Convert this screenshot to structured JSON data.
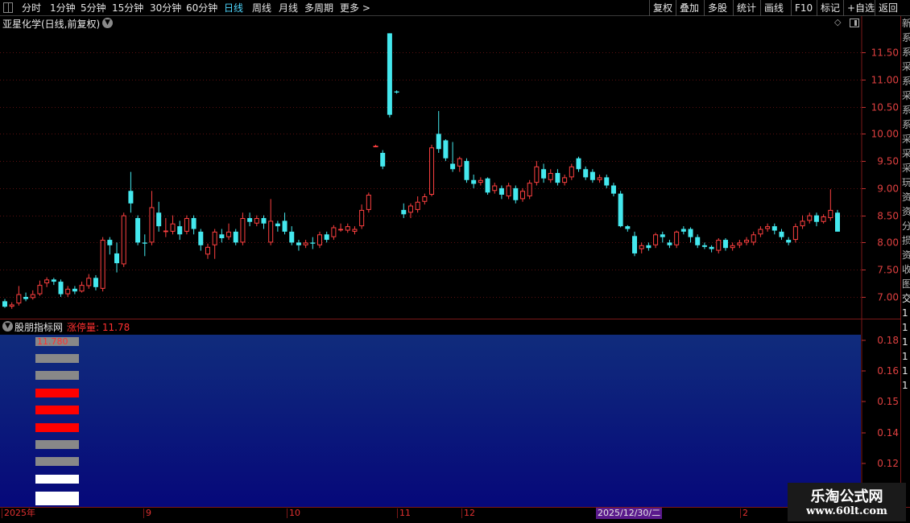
{
  "toolbar": {
    "periods": [
      "分时",
      "1分钟",
      "5分钟",
      "15分钟",
      "30分钟",
      "60分钟",
      "日线",
      "周线",
      "月线",
      "多周期",
      "更多 >"
    ],
    "active_period": "日线",
    "actions": [
      "复权",
      "叠加",
      "多股",
      "统计",
      "画线",
      "F10",
      "标记",
      "+自选",
      "返回"
    ]
  },
  "chart": {
    "title": "亚星化学(日线,前复权)",
    "y_ticks": [
      "11.50",
      "11.00",
      "10.50",
      "10.00",
      "9.50",
      "9.00",
      "8.50",
      "8.00",
      "7.50",
      "7.00"
    ]
  },
  "indicator": {
    "name": "股朋指标网",
    "series_label": "涨停量: 11.78",
    "top_value_label": "11.780",
    "y_ticks": [
      "0.18",
      "0.16",
      "0.15",
      "0.14",
      "0.12"
    ],
    "bar_colors": [
      "#888888",
      "#888888",
      "#888888",
      "#ff0000",
      "#ff0000",
      "#ff0000",
      "#888888",
      "#888888",
      "#ffffff",
      "#ffffff"
    ]
  },
  "date_axis": {
    "labels": [
      "2025年",
      "9",
      "10",
      "11",
      "12",
      "2"
    ],
    "cursor_date": "2025/12/30/二"
  },
  "right_strip_chars": [
    "新",
    "系",
    "系",
    "采",
    "系",
    "采",
    "系",
    "系",
    "采",
    "采",
    "采",
    "玩",
    "资",
    "资",
    "分",
    "损",
    "资",
    "收",
    "图",
    "交",
    "1",
    "1",
    "1",
    "1",
    "1",
    "1"
  ],
  "watermark": {
    "title": "乐淘公式网",
    "url": "www.60lt.com"
  },
  "colors": {
    "up": "#ff4040",
    "down": "#44e8ee",
    "grid": "#5a1010",
    "indicator_bg_top": "#102c7c",
    "indicator_bg_bottom": "#06087a"
  },
  "chart_data": {
    "type": "candlestick",
    "y_range": [
      6.6,
      11.9
    ],
    "candles": [
      [
        6.92,
        6.82,
        6.96,
        6.8
      ],
      [
        6.82,
        6.86,
        6.9,
        6.78
      ],
      [
        6.88,
        7.05,
        7.2,
        6.84
      ],
      [
        7.0,
        6.96,
        7.08,
        6.92
      ],
      [
        6.98,
        7.05,
        7.12,
        6.95
      ],
      [
        7.05,
        7.22,
        7.3,
        7.02
      ],
      [
        7.25,
        7.32,
        7.36,
        7.18
      ],
      [
        7.32,
        7.28,
        7.35,
        7.22
      ],
      [
        7.28,
        7.05,
        7.32,
        7.0
      ],
      [
        7.05,
        7.15,
        7.2,
        7.0
      ],
      [
        7.15,
        7.1,
        7.2,
        7.05
      ],
      [
        7.1,
        7.22,
        7.28,
        7.08
      ],
      [
        7.2,
        7.35,
        7.42,
        7.15
      ],
      [
        7.35,
        7.18,
        7.4,
        7.12
      ],
      [
        7.15,
        8.05,
        8.1,
        7.1
      ],
      [
        8.05,
        7.95,
        8.1,
        7.78
      ],
      [
        7.8,
        7.62,
        8.0,
        7.45
      ],
      [
        7.6,
        8.5,
        8.55,
        7.55
      ],
      [
        8.95,
        8.72,
        9.3,
        8.55
      ],
      [
        8.45,
        8.0,
        8.5,
        7.95
      ],
      [
        8.0,
        7.98,
        8.15,
        7.75
      ],
      [
        8.0,
        8.65,
        8.95,
        7.95
      ],
      [
        8.55,
        8.3,
        8.75,
        8.2
      ],
      [
        8.2,
        8.22,
        8.45,
        8.1
      ],
      [
        8.2,
        8.35,
        8.5,
        8.15
      ],
      [
        8.3,
        8.15,
        8.4,
        8.05
      ],
      [
        8.2,
        8.45,
        8.5,
        8.15
      ],
      [
        8.45,
        8.25,
        8.5,
        8.15
      ],
      [
        8.2,
        7.95,
        8.25,
        7.85
      ],
      [
        7.78,
        7.92,
        7.98,
        7.7
      ],
      [
        7.95,
        8.2,
        8.25,
        7.7
      ],
      [
        8.15,
        8.08,
        8.25,
        8.0
      ],
      [
        8.1,
        8.2,
        8.35,
        8.05
      ],
      [
        8.2,
        8.0,
        8.25,
        7.95
      ],
      [
        8.0,
        8.45,
        8.55,
        7.95
      ],
      [
        8.45,
        8.38,
        8.55,
        8.3
      ],
      [
        8.35,
        8.45,
        8.5,
        8.3
      ],
      [
        8.45,
        8.35,
        8.5,
        8.25
      ],
      [
        8.0,
        8.4,
        8.8,
        7.95
      ],
      [
        8.35,
        8.3,
        8.4,
        8.2
      ],
      [
        8.4,
        8.2,
        8.55,
        8.15
      ],
      [
        8.2,
        8.0,
        8.3,
        7.95
      ],
      [
        8.0,
        7.95,
        8.05,
        7.85
      ],
      [
        7.95,
        8.0,
        8.05,
        7.9
      ],
      [
        8.0,
        7.98,
        8.1,
        7.88
      ],
      [
        7.95,
        8.15,
        8.2,
        7.9
      ],
      [
        8.15,
        8.05,
        8.2,
        8.0
      ],
      [
        8.1,
        8.28,
        8.32,
        8.05
      ],
      [
        8.25,
        8.25,
        8.35,
        8.2
      ],
      [
        8.22,
        8.3,
        8.35,
        8.18
      ],
      [
        8.2,
        8.25,
        8.3,
        8.15
      ],
      [
        8.3,
        8.6,
        8.7,
        8.25
      ],
      [
        8.6,
        8.88,
        8.92,
        8.55
      ],
      [
        9.78,
        9.78,
        9.8,
        9.76
      ],
      [
        9.65,
        9.4,
        9.7,
        9.35
      ],
      [
        11.85,
        10.35,
        11.85,
        10.3
      ],
      [
        10.78,
        10.76,
        10.8,
        10.74
      ],
      [
        8.6,
        8.52,
        8.72,
        8.45
      ],
      [
        8.55,
        8.68,
        8.72,
        8.45
      ],
      [
        8.6,
        8.75,
        8.85,
        8.55
      ],
      [
        8.75,
        8.85,
        8.9,
        8.7
      ],
      [
        8.88,
        9.75,
        9.8,
        8.85
      ],
      [
        10.0,
        9.72,
        10.42,
        9.65
      ],
      [
        9.88,
        9.55,
        9.9,
        9.5
      ],
      [
        9.45,
        9.35,
        9.85,
        9.3
      ],
      [
        9.4,
        9.55,
        9.58,
        9.3
      ],
      [
        9.5,
        9.15,
        9.55,
        9.1
      ],
      [
        9.15,
        9.08,
        9.25,
        9.0
      ],
      [
        9.1,
        9.15,
        9.2,
        9.05
      ],
      [
        9.18,
        8.92,
        9.2,
        8.88
      ],
      [
        8.95,
        9.05,
        9.1,
        8.9
      ],
      [
        9.0,
        8.88,
        9.05,
        8.8
      ],
      [
        8.85,
        9.05,
        9.1,
        8.8
      ],
      [
        9.0,
        8.78,
        9.05,
        8.72
      ],
      [
        8.8,
        8.95,
        9.0,
        8.75
      ],
      [
        8.85,
        9.1,
        9.15,
        8.8
      ],
      [
        9.1,
        9.4,
        9.5,
        9.05
      ],
      [
        9.35,
        9.18,
        9.45,
        9.1
      ],
      [
        9.15,
        9.28,
        9.35,
        9.1
      ],
      [
        9.28,
        9.1,
        9.35,
        9.05
      ],
      [
        9.1,
        9.2,
        9.25,
        9.05
      ],
      [
        9.2,
        9.4,
        9.45,
        9.15
      ],
      [
        9.55,
        9.35,
        9.58,
        9.3
      ],
      [
        9.35,
        9.2,
        9.4,
        9.15
      ],
      [
        9.3,
        9.15,
        9.35,
        9.1
      ],
      [
        9.15,
        9.2,
        9.25,
        9.1
      ],
      [
        9.2,
        9.05,
        9.25,
        9.0
      ],
      [
        9.05,
        8.9,
        9.1,
        8.85
      ],
      [
        8.9,
        8.3,
        8.95,
        8.28
      ],
      [
        8.3,
        8.25,
        8.32,
        8.2
      ],
      [
        8.12,
        7.8,
        8.2,
        7.75
      ],
      [
        7.88,
        7.95,
        8.0,
        7.8
      ],
      [
        7.95,
        7.9,
        8.0,
        7.85
      ],
      [
        7.95,
        8.15,
        8.18,
        7.9
      ],
      [
        8.15,
        8.1,
        8.2,
        8.0
      ],
      [
        8.0,
        7.95,
        8.05,
        7.9
      ],
      [
        7.95,
        8.2,
        8.22,
        7.9
      ],
      [
        8.25,
        8.2,
        8.3,
        8.15
      ],
      [
        8.25,
        8.1,
        8.28,
        8.0
      ],
      [
        8.1,
        7.95,
        8.15,
        7.9
      ],
      [
        7.95,
        7.92,
        8.0,
        7.88
      ],
      [
        7.92,
        7.88,
        7.95,
        7.82
      ],
      [
        7.85,
        8.05,
        8.08,
        7.8
      ],
      [
        8.05,
        7.9,
        8.08,
        7.85
      ],
      [
        7.9,
        7.95,
        8.0,
        7.85
      ],
      [
        7.95,
        8.0,
        8.05,
        7.9
      ],
      [
        8.0,
        8.05,
        8.1,
        7.95
      ],
      [
        8.0,
        8.15,
        8.2,
        7.95
      ],
      [
        8.15,
        8.25,
        8.3,
        8.1
      ],
      [
        8.25,
        8.3,
        8.35,
        8.2
      ],
      [
        8.3,
        8.22,
        8.35,
        8.15
      ],
      [
        8.2,
        8.1,
        8.25,
        8.05
      ],
      [
        8.05,
        8.0,
        8.1,
        7.95
      ],
      [
        8.05,
        8.3,
        8.35,
        8.0
      ],
      [
        8.3,
        8.4,
        8.5,
        8.25
      ],
      [
        8.4,
        8.5,
        8.55,
        8.35
      ],
      [
        8.5,
        8.38,
        8.55,
        8.3
      ],
      [
        8.38,
        8.48,
        8.52,
        8.35
      ],
      [
        8.45,
        8.6,
        8.98,
        8.4
      ],
      [
        8.55,
        8.2,
        8.6,
        8.2
      ]
    ]
  }
}
